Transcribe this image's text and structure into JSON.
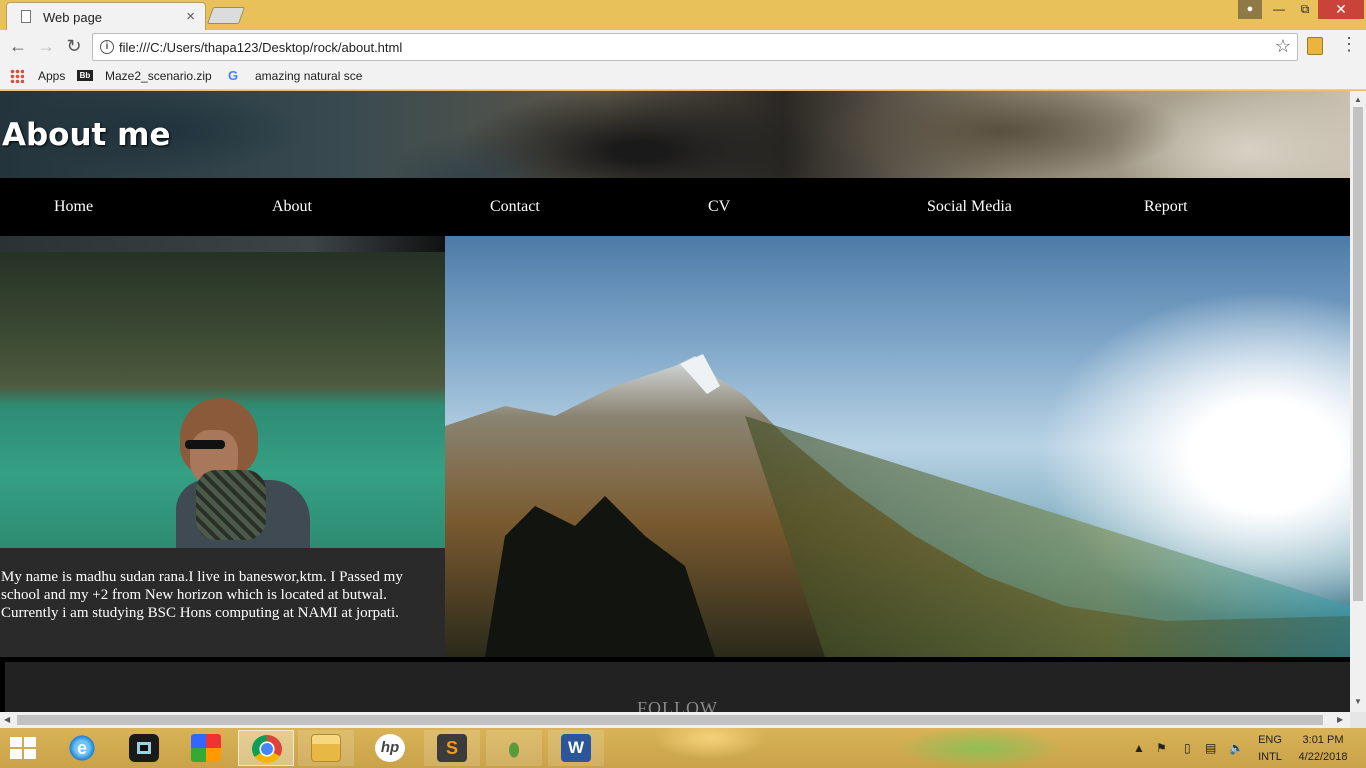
{
  "browser": {
    "tab_title": "Web page",
    "url": "file:///C:/Users/thapa123/Desktop/rock/about.html",
    "bookmarks": [
      "Apps",
      "Maze2_scenario.zip",
      "amazing natural sce"
    ]
  },
  "page": {
    "title": "About me",
    "nav": [
      "Home",
      "About",
      "Contact",
      "CV",
      "Social Media",
      "Report"
    ],
    "bio": "My name is madhu sudan rana.I live in baneswor,ktm. I Passed my school and my +2 from New horizon which is located at butwal. Currently i am studying BSC Hons computing at NAMI at jorpati.",
    "footer_heading": "FOLLOW"
  },
  "taskbar": {
    "apps": [
      "start-icon",
      "internet-explorer-icon",
      "media-player-icon",
      "paint-icon",
      "chrome-icon",
      "file-explorer-icon",
      "hp-icon",
      "sublime-text-icon",
      "footprint-icon",
      "word-icon"
    ],
    "tray": {
      "lang_top": "ENG",
      "lang_bottom": "INTL",
      "time": "3:01 PM",
      "date": "4/22/2018"
    }
  },
  "colors": {
    "nav_bg": "#000000",
    "bio_bg": "#2a2a2a",
    "footer_bg": "#222222",
    "taskbar": "#d9b356",
    "close_button": "#c9433a"
  }
}
